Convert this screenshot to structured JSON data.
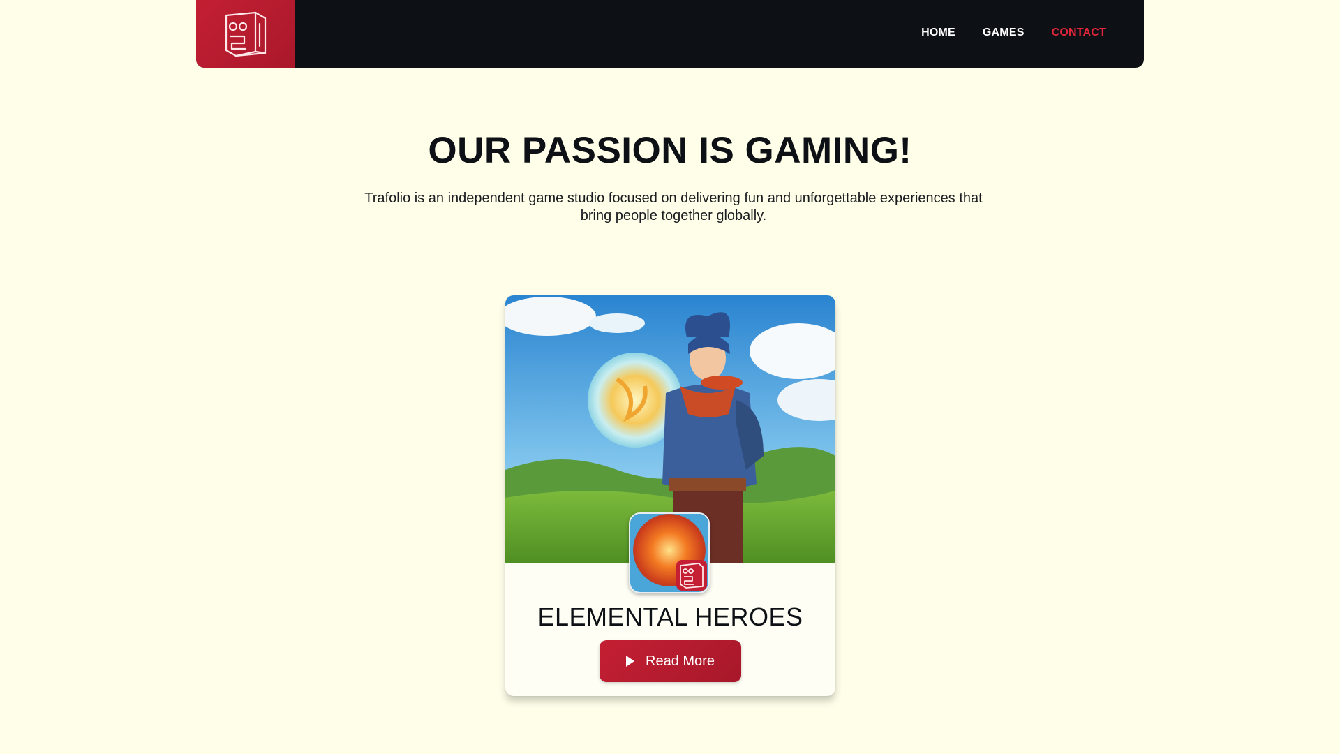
{
  "nav": {
    "logo_icon": "trafolio-logo-icon",
    "links": [
      {
        "label": "HOME",
        "active": false
      },
      {
        "label": "GAMES",
        "active": false
      },
      {
        "label": "CONTACT",
        "active": true
      }
    ]
  },
  "hero": {
    "title": "OUR PASSION IS GAMING!",
    "text": "Trafolio is an independent game studio focused on delivering fun and unforgettable experiences that bring people together globally."
  },
  "game_card": {
    "art": "hero-warrior-holding-magic-orb-illustration",
    "icon": "elemental-heroes-app-icon",
    "title": "ELEMENTAL HEROES",
    "button_label": "Read More",
    "button_icon": "play-icon"
  },
  "colors": {
    "background": "#fefee9",
    "nav_bg": "#0d1115",
    "brand_red": "#c41f33",
    "active_link": "#e1253a",
    "text": "#0d1014"
  }
}
